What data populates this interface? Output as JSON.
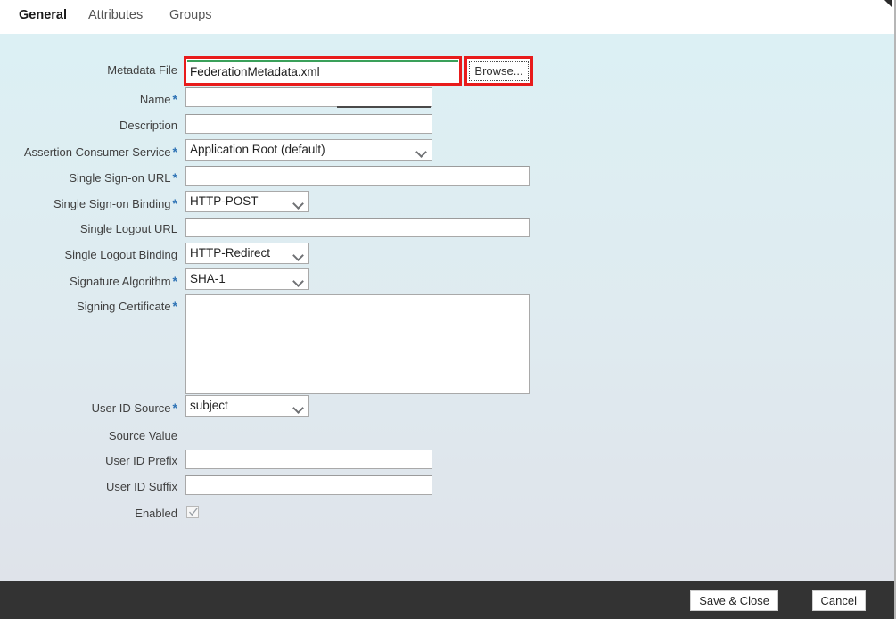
{
  "tabs": [
    {
      "label": "General",
      "active": true
    },
    {
      "label": "Attributes",
      "active": false
    },
    {
      "label": "Groups",
      "active": false
    }
  ],
  "form": {
    "metadata_file": {
      "label": "Metadata File",
      "value": "FederationMetadata.xml",
      "required": false,
      "highlight_color": "#e81b1b",
      "accent_color": "#3aa05a"
    },
    "browse_button": {
      "label": "Browse...",
      "highlight_color": "#e81b1b"
    },
    "name": {
      "label": "Name",
      "value": "",
      "required": true
    },
    "description": {
      "label": "Description",
      "value": "",
      "required": false
    },
    "assertion_consumer_service": {
      "label": "Assertion Consumer Service",
      "value": "Application Root (default)",
      "required": true
    },
    "single_signon_url": {
      "label": "Single Sign-on URL",
      "value": "",
      "required": true
    },
    "single_signon_binding": {
      "label": "Single Sign-on Binding",
      "value": "HTTP-POST",
      "required": true
    },
    "single_logout_url": {
      "label": "Single Logout URL",
      "value": "",
      "required": false
    },
    "single_logout_binding": {
      "label": "Single Logout Binding",
      "value": "HTTP-Redirect",
      "required": false
    },
    "signature_algorithm": {
      "label": "Signature Algorithm",
      "value": "SHA-1",
      "required": true
    },
    "signing_certificate": {
      "label": "Signing Certificate",
      "value": "",
      "required": true
    },
    "user_id_source": {
      "label": "User ID Source",
      "value": "subject",
      "required": true
    },
    "source_value": {
      "label": "Source Value",
      "value": "",
      "required": false
    },
    "user_id_prefix": {
      "label": "User ID Prefix",
      "value": "",
      "required": false
    },
    "user_id_suffix": {
      "label": "User ID Suffix",
      "value": "",
      "required": false
    },
    "enabled": {
      "label": "Enabled",
      "checked": true,
      "required": false
    }
  },
  "footer": {
    "save_label": "Save & Close",
    "cancel_label": "Cancel",
    "background_color": "#333333"
  },
  "required_marker": "*"
}
